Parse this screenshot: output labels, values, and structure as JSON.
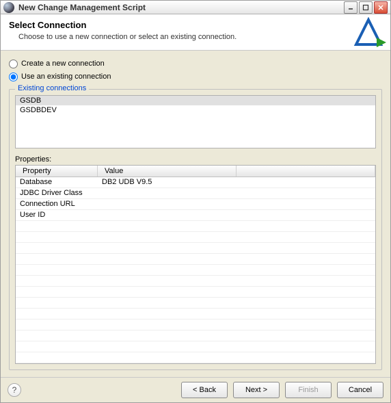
{
  "window": {
    "title": "New Change Management Script"
  },
  "header": {
    "title": "Select Connection",
    "subtitle": "Choose to use a new connection or select an existing connection."
  },
  "radios": {
    "create": "Create a new connection",
    "use": "Use an existing connection",
    "selected": "use"
  },
  "existing": {
    "group_title": "Existing connections",
    "items": [
      {
        "label": "GSDB",
        "selected": true
      },
      {
        "label": "GSDBDEV",
        "selected": false
      }
    ]
  },
  "properties": {
    "label": "Properties:",
    "columns": {
      "property": "Property",
      "value": "Value"
    },
    "rows": [
      {
        "property": "Database",
        "value": "DB2 UDB V9.5"
      },
      {
        "property": "JDBC Driver Class",
        "value": ""
      },
      {
        "property": "Connection URL",
        "value": ""
      },
      {
        "property": "User ID",
        "value": ""
      }
    ],
    "blank_rows": 13
  },
  "footer": {
    "back": "< Back",
    "next": "Next >",
    "finish": "Finish",
    "cancel": "Cancel"
  }
}
